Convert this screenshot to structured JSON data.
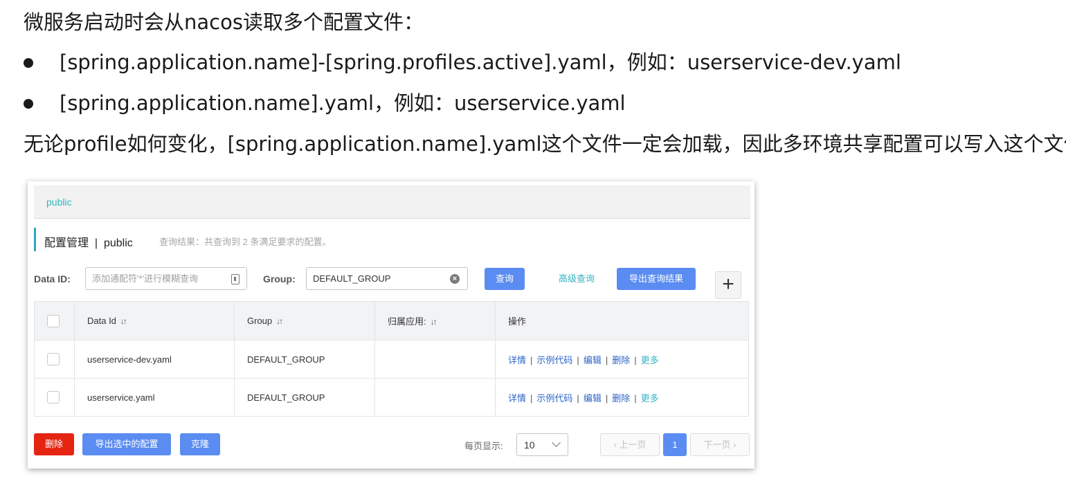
{
  "slide": {
    "line1": "微服务启动时会从nacos读取多个配置文件：",
    "bullets": [
      "[spring.application.name]-[spring.profiles.active].yaml，例如：userservice-dev.yaml",
      "[spring.application.name].yaml，例如：userservice.yaml"
    ],
    "line4": "无论profile如何变化，[spring.application.name].yaml这个文件一定会加载，因此多环境共享配置可以写入这个文件"
  },
  "panel": {
    "namespace_link": "public",
    "title": "配置管理  |  public",
    "query_result": "查询结果：共查询到 2 条满足要求的配置。",
    "filters": {
      "data_id_label": "Data ID:",
      "data_id_placeholder": "添加通配符'*'进行模糊查询",
      "group_label": "Group:",
      "group_value": "DEFAULT_GROUP"
    },
    "buttons": {
      "query": "查询",
      "advanced": "高级查询",
      "export_results": "导出查询结果",
      "add": "+"
    },
    "table": {
      "headers": [
        "Data Id",
        "Group",
        "归属应用:",
        "操作"
      ],
      "rows": [
        {
          "data_id": "userservice-dev.yaml",
          "group": "DEFAULT_GROUP",
          "app": ""
        },
        {
          "data_id": "userservice.yaml",
          "group": "DEFAULT_GROUP",
          "app": ""
        }
      ],
      "ops": [
        "详情",
        "示例代码",
        "编辑",
        "删除",
        "更多"
      ],
      "separator": "|"
    },
    "footer": {
      "delete": "删除",
      "export_selected": "导出选中的配置",
      "clone": "克隆",
      "page_size_label": "每页显示:",
      "page_size_value": "10",
      "prev": "上一页",
      "current_page": "1",
      "next": "下一页"
    }
  },
  "colors": {
    "primary_blue": "#5b8cf2",
    "teal_link": "#33b3c4",
    "danger_red": "#e62412",
    "op_link": "#2b64c7"
  }
}
